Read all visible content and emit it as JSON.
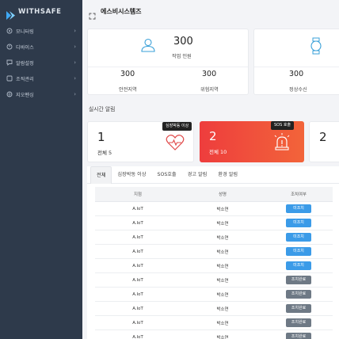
{
  "app": {
    "brand": "WITHSAFE",
    "page_title": "에스비시스템즈"
  },
  "sidebar": {
    "items": [
      {
        "label": "모니터링",
        "icon": "monitor-icon"
      },
      {
        "label": "디바이스",
        "icon": "device-icon"
      },
      {
        "label": "알람설정",
        "icon": "alarm-icon"
      },
      {
        "label": "조직관리",
        "icon": "org-icon"
      },
      {
        "label": "지오펜싱",
        "icon": "geofence-icon"
      }
    ]
  },
  "stats": {
    "workers": {
      "value": "300",
      "label": "작업 인원"
    },
    "safe_zone": {
      "value": "300",
      "label": "안전지역"
    },
    "danger_zone": {
      "value": "300",
      "label": "위험지역"
    },
    "device": {
      "value": "300"
    },
    "normal_recv": {
      "value": "300",
      "label": "정상수신"
    }
  },
  "realtime": {
    "title": "실시간 알림",
    "cards": [
      {
        "num": "1",
        "total": "전체 5",
        "badge": "심장박동 이상",
        "icon": "heartbeat-icon"
      },
      {
        "num": "2",
        "total": "전체 10",
        "badge": "SOS 호출",
        "icon": "siren-icon"
      },
      {
        "num": "2"
      }
    ]
  },
  "tabs": [
    "전체",
    "심장박동 이상",
    "SOS호출",
    "경고 알림",
    "환경 알림"
  ],
  "table": {
    "headers": [
      "지점",
      "성명",
      "조치여부"
    ],
    "rows": [
      {
        "site": "A.IoT",
        "name": "박소연",
        "status": "미조치",
        "done": false
      },
      {
        "site": "A.IoT",
        "name": "박소연",
        "status": "미조치",
        "done": false
      },
      {
        "site": "A.IoT",
        "name": "박소연",
        "status": "미조치",
        "done": false
      },
      {
        "site": "A.IoT",
        "name": "박소연",
        "status": "미조치",
        "done": false
      },
      {
        "site": "A.IoT",
        "name": "박소연",
        "status": "미조치",
        "done": false
      },
      {
        "site": "A.IoT",
        "name": "박소연",
        "status": "조치완료",
        "done": true
      },
      {
        "site": "A.IoT",
        "name": "박소연",
        "status": "조치완료",
        "done": true
      },
      {
        "site": "A.IoT",
        "name": "박소연",
        "status": "조치완료",
        "done": true
      },
      {
        "site": "A.IoT",
        "name": "박소연",
        "status": "조치완료",
        "done": true
      },
      {
        "site": "A.IoT",
        "name": "박소연",
        "status": "조치완료",
        "done": true
      }
    ]
  },
  "colors": {
    "sidebar": "#2e3a4b",
    "accent_blue": "#3b9be8",
    "alert_red": "#ee3d3d",
    "done_gray": "#6e7985"
  }
}
